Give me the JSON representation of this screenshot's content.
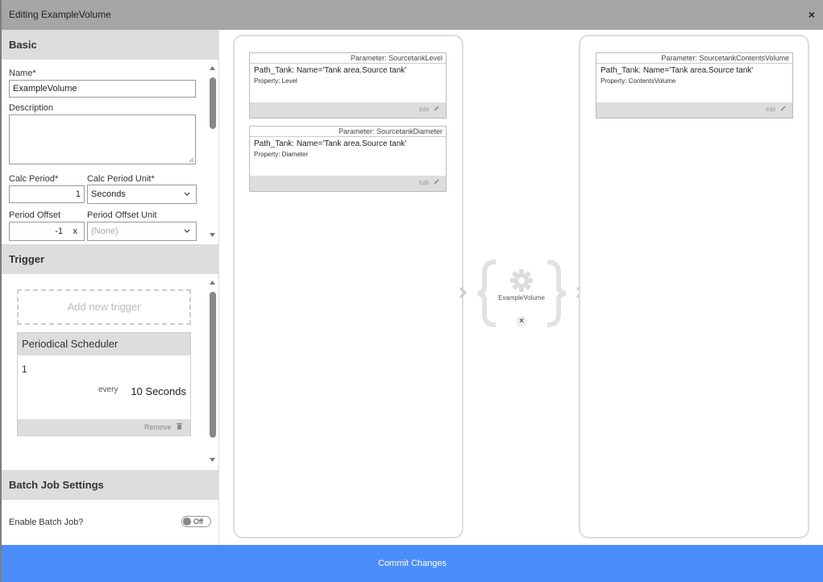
{
  "dialog": {
    "title": "Editing ExampleVolume",
    "close_glyph": "×"
  },
  "basic": {
    "heading": "Basic",
    "name_label": "Name*",
    "name_value": "ExampleVolume",
    "description_label": "Description",
    "description_value": "",
    "calc_period_label": "Calc Period*",
    "calc_period_value": "1",
    "calc_period_unit_label": "Calc Period Unit*",
    "calc_period_unit_value": "Seconds",
    "period_offset_label": "Period Offset",
    "period_offset_value": "-1",
    "period_offset_clear": "x",
    "period_offset_unit_label": "Period Offset Unit",
    "period_offset_unit_value": "(None)"
  },
  "trigger": {
    "heading": "Trigger",
    "add_label": "Add new trigger",
    "scheduler": {
      "title": "Periodical Scheduler",
      "value": "1",
      "every_label": "every",
      "interval": "10 Seconds",
      "remove_label": "Remove"
    }
  },
  "batch": {
    "heading": "Batch Job Settings",
    "enable_label": "Enable Batch Job?",
    "toggle_label": "Off"
  },
  "inputs": [
    {
      "param": "Parameter: SourcetankLevel",
      "path": "Path_Tank: Name='Tank area.Source tank'",
      "property": "Property: Level",
      "edit": "Edit"
    },
    {
      "param": "Parameter: SourcetankDiameter",
      "path": "Path_Tank: Name='Tank area.Source tank'",
      "property": "Property: Diameter",
      "edit": "Edit"
    }
  ],
  "outputs": [
    {
      "param": "Parameter: SourcetankContentsVolume",
      "path": "Path_Tank: Name='Tank area.Source tank'",
      "property": "Property: ContentsVolume",
      "edit": "Edit"
    }
  ],
  "calculation": {
    "name": "ExampleVolume",
    "icon": "gear-icon",
    "remove_glyph": "×"
  },
  "commit_label": "Commit Changes",
  "colors": {
    "accent": "#4b8df8",
    "section": "#dddddd",
    "titlebar": "#a6a6a6"
  }
}
